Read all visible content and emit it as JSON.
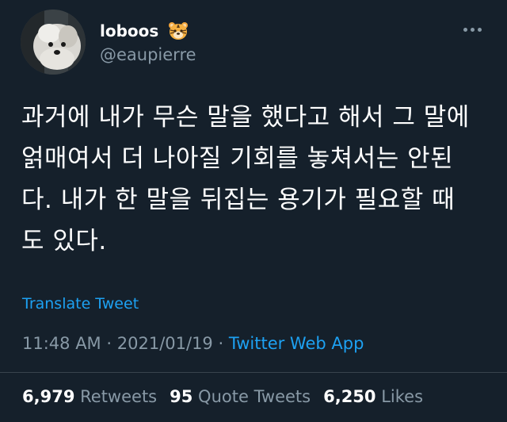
{
  "author": {
    "display_name": "loboos",
    "name_emoji": "tiger-face-emoji",
    "handle": "@eaupierre",
    "avatar": "white-dog-avatar"
  },
  "tweet": {
    "lines": [
      "과거에 내가 무슨 말을 했다고 해서 그 말에",
      "얽매여서 더 나아질 기회를 놓쳐서는 안된",
      "다. 내가 한 말을 뒤집는 용기가 필요할 때",
      "도 있다."
    ],
    "translate_label": "Translate Tweet",
    "time": "11:48 AM",
    "separator": "·",
    "date": "2021/01/19",
    "source": "Twitter Web App"
  },
  "stats": {
    "retweets_count": "6,979",
    "retweets_label": "Retweets",
    "quote_count": "95",
    "quote_label": "Quote Tweets",
    "likes_count": "6,250",
    "likes_label": "Likes"
  },
  "colors": {
    "background": "#15202b",
    "accent": "#1da1f2",
    "secondary_text": "#8899a6"
  }
}
